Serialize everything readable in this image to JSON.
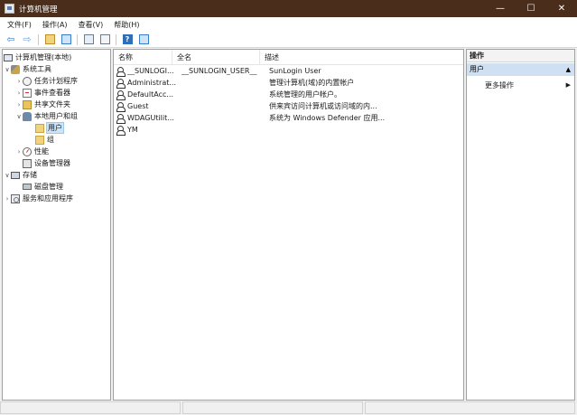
{
  "window": {
    "title": "计算机管理",
    "controls": {
      "minimize": "—",
      "maximize": "☐",
      "close": "✕"
    }
  },
  "menu": [
    "文件(F)",
    "操作(A)",
    "查看(V)",
    "帮助(H)"
  ],
  "toolbar": {
    "icons": [
      "back-arrow-icon",
      "forward-arrow-icon",
      "up-folder-icon",
      "show-hide-tree-icon",
      "refresh-icon",
      "export-icon",
      "help-icon",
      "show-hide-action-icon"
    ],
    "back": "⇦",
    "forward": "⇨",
    "help_glyph": "?"
  },
  "tree": {
    "root": "计算机管理(本地)",
    "system_tools": "系统工具",
    "task_scheduler": "任务计划程序",
    "event_viewer": "事件查看器",
    "shared_folders": "共享文件夹",
    "local_users": "本地用户和组",
    "users": "用户",
    "groups": "组",
    "performance": "性能",
    "device_manager": "设备管理器",
    "storage": "存储",
    "disk_management": "磁盘管理",
    "services": "服务和应用程序"
  },
  "list": {
    "columns": [
      "名称",
      "全名",
      "描述"
    ],
    "rows": [
      {
        "name": "__SUNLOGI...",
        "fullname": "__SUNLOGIN_USER__",
        "desc": "SunLogin User"
      },
      {
        "name": "Administrat...",
        "fullname": "",
        "desc": "管理计算机(域)的内置帐户"
      },
      {
        "name": "DefaultAcc...",
        "fullname": "",
        "desc": "系统管理的用户帐户。"
      },
      {
        "name": "Guest",
        "fullname": "",
        "desc": "供来宾访问计算机或访问域的内..."
      },
      {
        "name": "WDAGUtilit...",
        "fullname": "",
        "desc": "系统为 Windows Defender 应用..."
      },
      {
        "name": "YM",
        "fullname": "",
        "desc": ""
      }
    ]
  },
  "actions": {
    "header": "操作",
    "section": "用户",
    "more": "更多操作",
    "caret_up": "▲",
    "arrow_right": "▶"
  }
}
